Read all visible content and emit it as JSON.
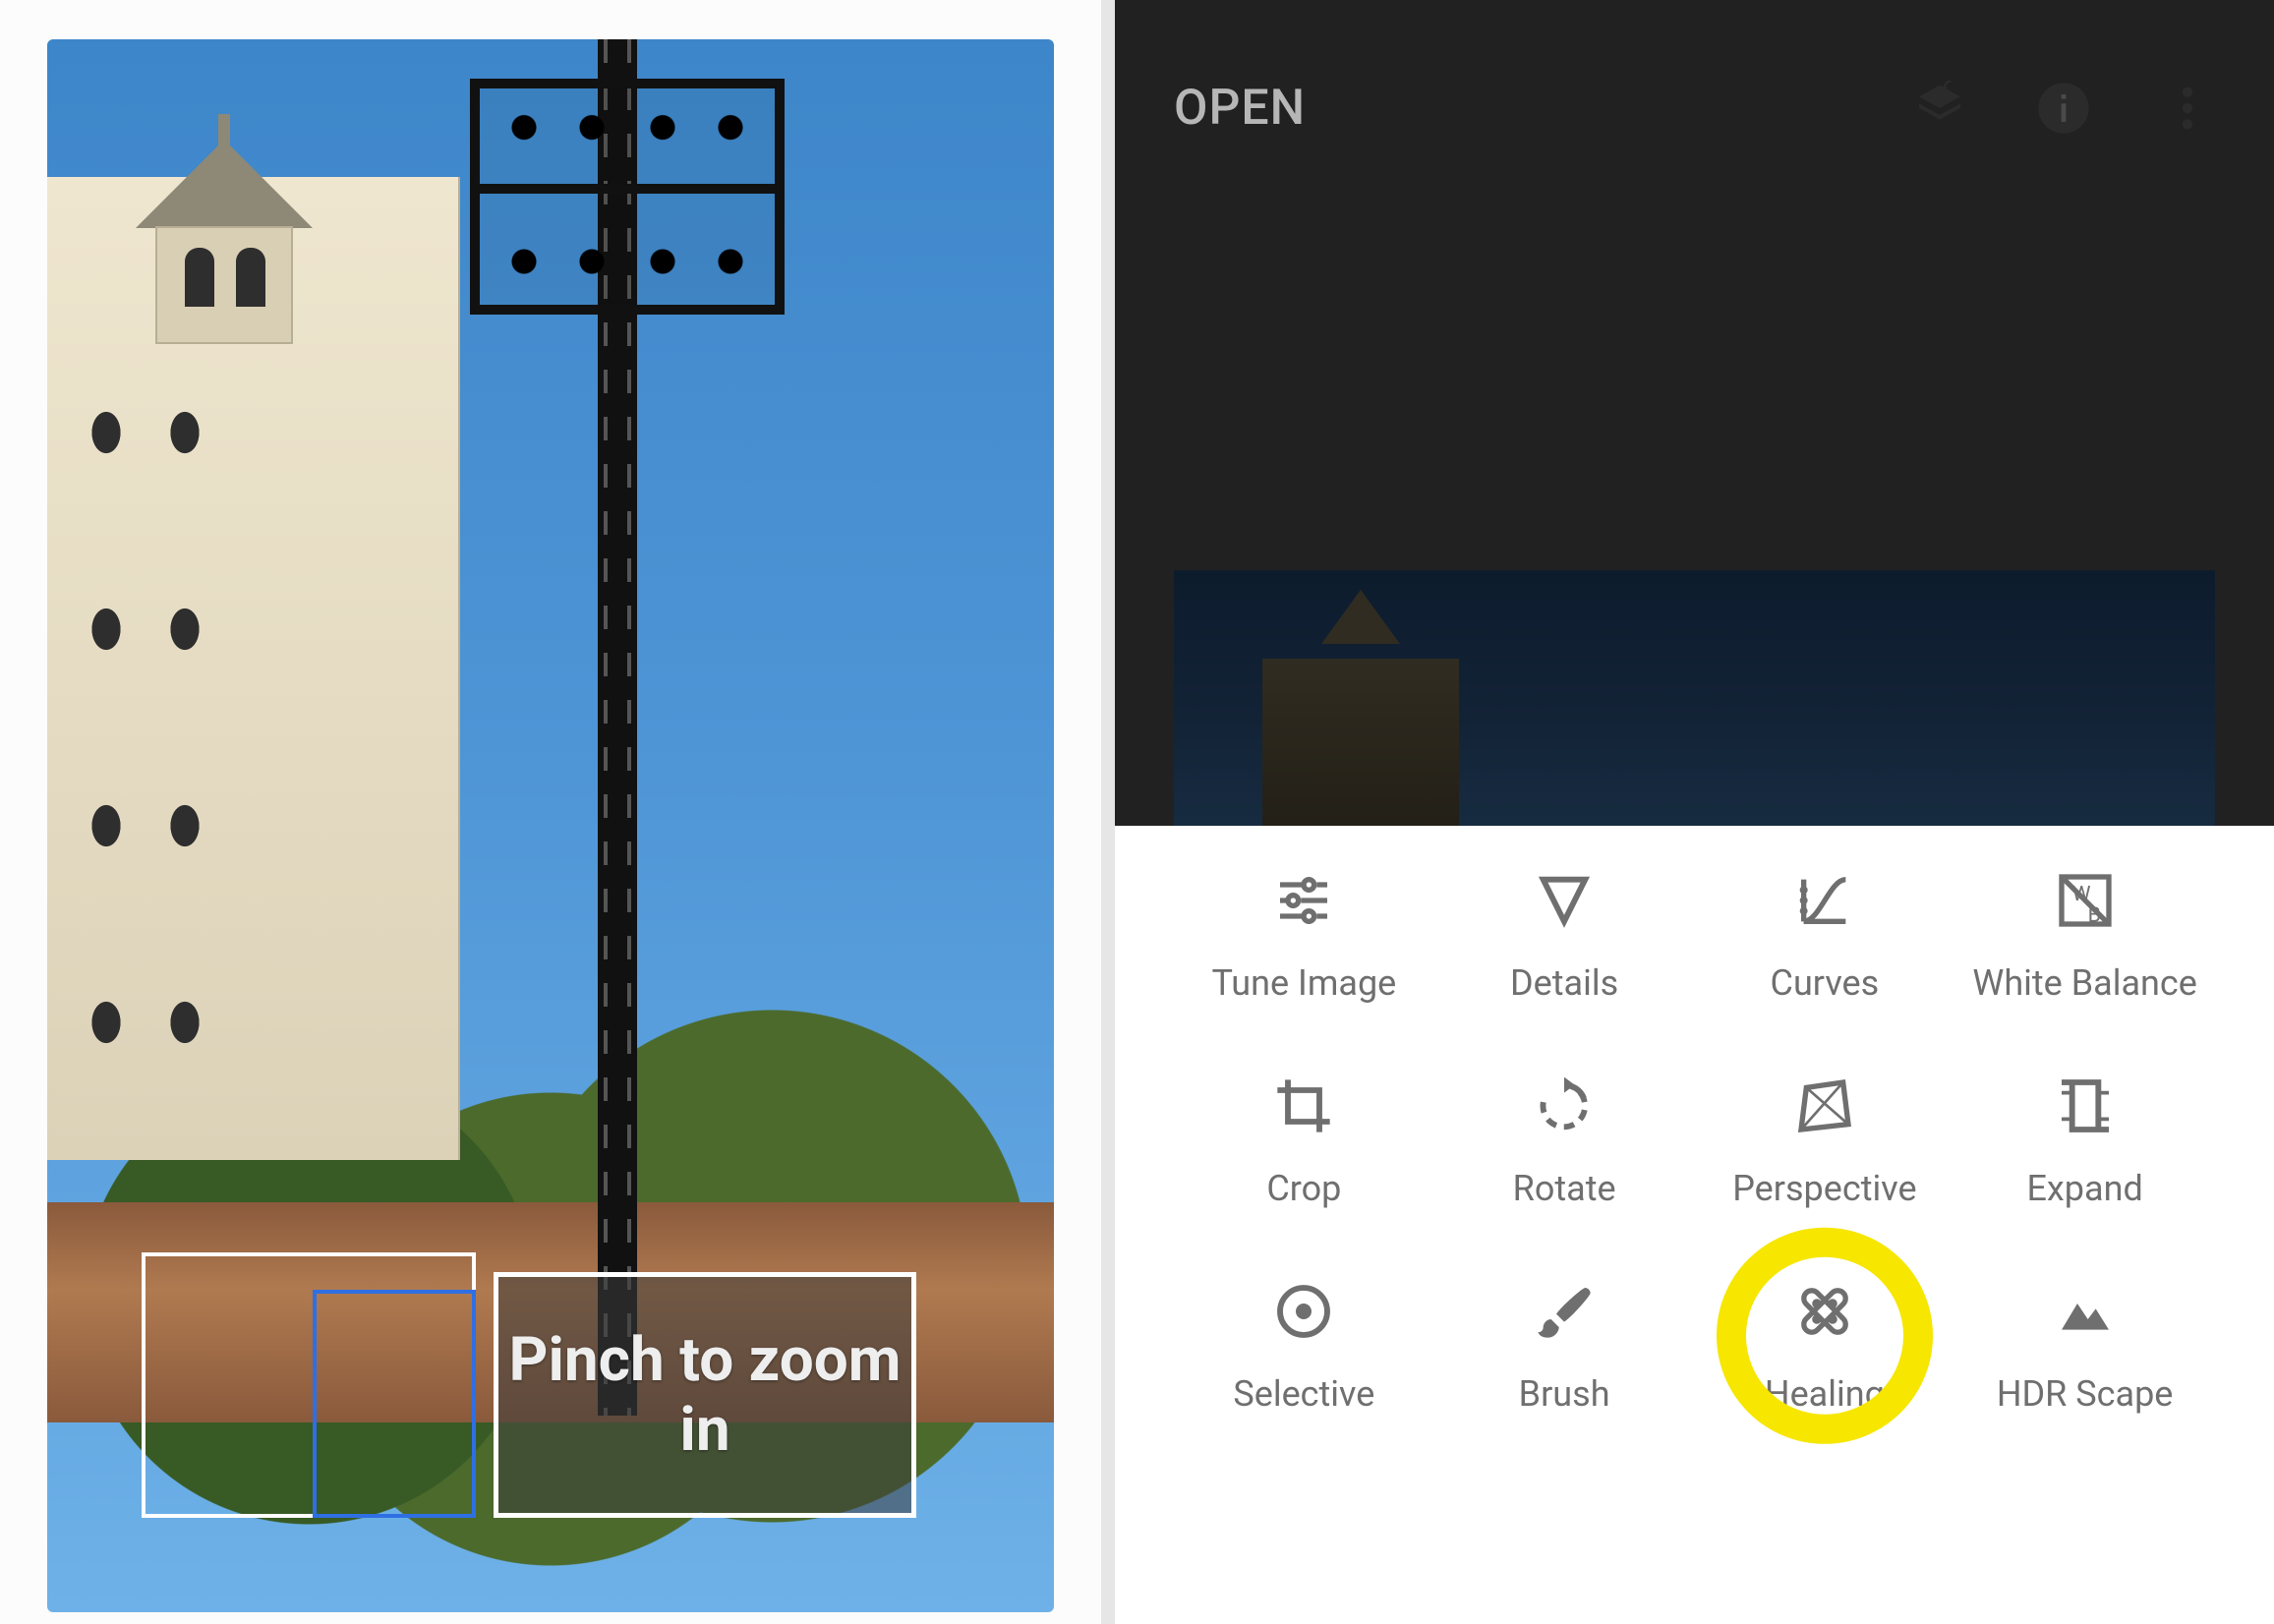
{
  "left": {
    "hint_text": "Pinch to zoom in"
  },
  "right": {
    "topbar": {
      "open_label": "OPEN",
      "icons": {
        "layers": "layers-undo-icon",
        "info": "info-icon",
        "menu": "more-vert-icon"
      }
    },
    "tools": [
      {
        "id": "tune-image",
        "label": "Tune Image"
      },
      {
        "id": "details",
        "label": "Details"
      },
      {
        "id": "curves",
        "label": "Curves"
      },
      {
        "id": "white-balance",
        "label": "White Balance"
      },
      {
        "id": "crop",
        "label": "Crop"
      },
      {
        "id": "rotate",
        "label": "Rotate"
      },
      {
        "id": "perspective",
        "label": "Perspective"
      },
      {
        "id": "expand",
        "label": "Expand"
      },
      {
        "id": "selective",
        "label": "Selective"
      },
      {
        "id": "brush",
        "label": "Brush"
      },
      {
        "id": "healing",
        "label": "Healing"
      },
      {
        "id": "hdr-scape",
        "label": "HDR Scape"
      }
    ],
    "highlighted_tool": "healing"
  }
}
